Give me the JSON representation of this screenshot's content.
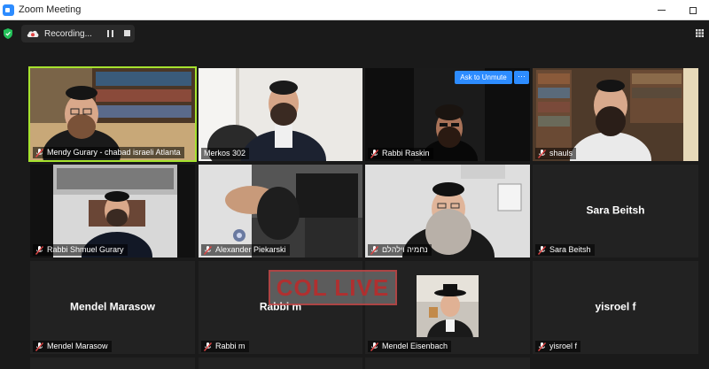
{
  "window": {
    "title": "Zoom Meeting"
  },
  "toolbar": {
    "recording_label": "Recording..."
  },
  "controls": {
    "ask_to_unmute": "Ask to Unmute",
    "more": "···"
  },
  "participants": [
    {
      "name": "Mendy Gurary - chabad israeli Atlanta",
      "muted": true,
      "speaking": true
    },
    {
      "name": "Merkos 302",
      "muted": false
    },
    {
      "name": "Rabbi Raskin",
      "muted": true
    },
    {
      "name": "shauls",
      "muted": true
    },
    {
      "name": "Rabbi Shmuel Gurary",
      "muted": true
    },
    {
      "name": "Alexander Piekarski",
      "muted": true
    },
    {
      "name": "נחמיה וילהלם",
      "muted": true
    },
    {
      "name": "Sara Beitsh",
      "display_name": "Sara Beitsh",
      "muted": true,
      "video": false
    },
    {
      "name": "Mendel Marasow",
      "display_name": "Mendel Marasow",
      "muted": true,
      "video": false
    },
    {
      "name": "Rabbi m",
      "display_name": "Rabbi m",
      "muted": true,
      "video": false
    },
    {
      "name": "Mendel Eisenbach",
      "muted": true
    },
    {
      "name": "yisroel f",
      "display_name": "yisroel f",
      "muted": true,
      "video": false
    }
  ],
  "watermark": {
    "text": "COL LIVE"
  },
  "colors": {
    "accent": "#2d8cff",
    "speaking_border": "#a6e22e",
    "muted_icon": "#e04444",
    "background": "#1a1a1a"
  }
}
